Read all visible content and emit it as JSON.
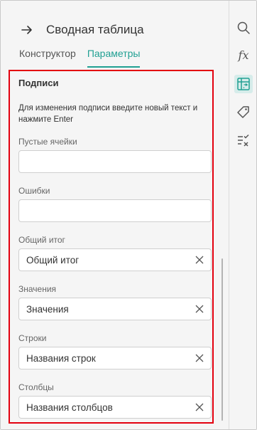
{
  "header": {
    "title": "Сводная таблица"
  },
  "tabs": [
    {
      "label": "Конструктор",
      "active": false
    },
    {
      "label": "Параметры",
      "active": true
    }
  ],
  "section": {
    "title": "Подписи",
    "hint": "Для изменения подписи введите новый текст и нажмите Enter"
  },
  "fields": {
    "empty_cells": {
      "label": "Пустые ячейки",
      "value": ""
    },
    "errors": {
      "label": "Ошибки",
      "value": ""
    },
    "grand_total": {
      "label": "Общий итог",
      "value": "Общий итог"
    },
    "values": {
      "label": "Значения",
      "value": "Значения"
    },
    "rows": {
      "label": "Строки",
      "value": "Названия строк"
    },
    "columns": {
      "label": "Столбцы",
      "value": "Названия столбцов"
    }
  },
  "toolbar": {
    "items": [
      "search-icon",
      "function-icon",
      "pivot-table-icon",
      "tag-icon",
      "checklist-icon"
    ],
    "function_glyph": "fx"
  },
  "colors": {
    "accent": "#21a093",
    "highlight": "#e3000f",
    "active_tool_bg": "#d6ecea"
  }
}
